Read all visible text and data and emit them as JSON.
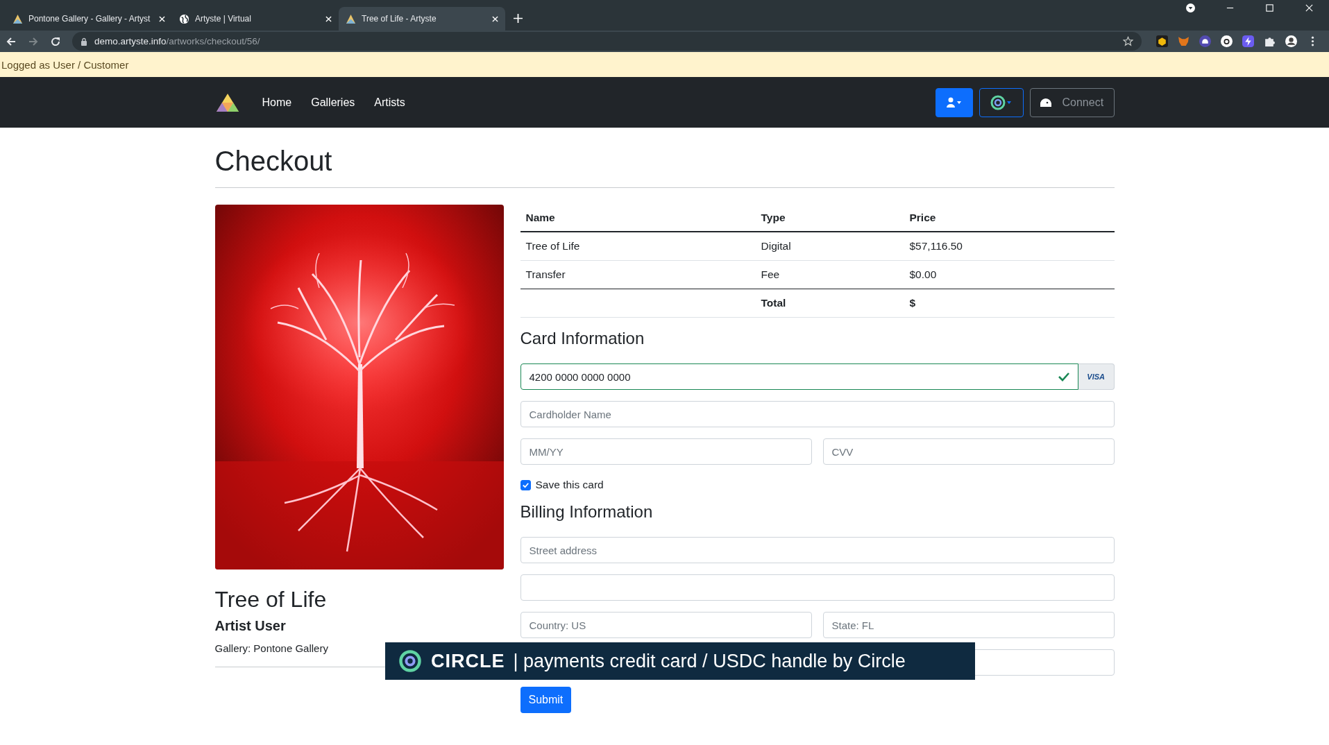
{
  "browser": {
    "tabs": [
      {
        "title": "Pontone Gallery - Gallery - Artyst",
        "selected": false
      },
      {
        "title": "Artyste | Virtual",
        "selected": false
      },
      {
        "title": "Tree of Life - Artyste",
        "selected": true
      }
    ],
    "url_host": "demo.artyste.info",
    "url_path": "/artworks/checkout/56/"
  },
  "notice": "Logged as User / Customer",
  "navbar": {
    "links": [
      "Home",
      "Galleries",
      "Artists"
    ],
    "connect_label": "Connect"
  },
  "page_title": "Checkout",
  "artwork": {
    "title": "Tree of Life",
    "artist": "Artist User",
    "gallery": "Gallery: Pontone Gallery"
  },
  "table": {
    "columns": [
      "Name",
      "Type",
      "Price"
    ],
    "rows": [
      [
        "Tree of Life",
        "Digital",
        "$57,116.50"
      ],
      [
        "Transfer",
        "Fee",
        "$0.00"
      ]
    ],
    "total": {
      "label": "Total",
      "value": "$"
    }
  },
  "card": {
    "heading": "Card Information",
    "number": "4200 0000 0000 0000",
    "valid": true,
    "brand": "VISA",
    "cardholder_placeholder": "Cardholder Name",
    "expiry_placeholder": "MM/YY",
    "cvv_placeholder": "CVV",
    "save": {
      "label": "Save this card",
      "checked": true
    }
  },
  "billing": {
    "heading": "Billing Information",
    "street_placeholder": "Street address",
    "country_placeholder": "Country: US",
    "state_placeholder": "State: FL"
  },
  "submit": "Submit",
  "caption": {
    "brand": "CIRCLE",
    "text": "| payments credit card / USDC handle by Circle"
  }
}
